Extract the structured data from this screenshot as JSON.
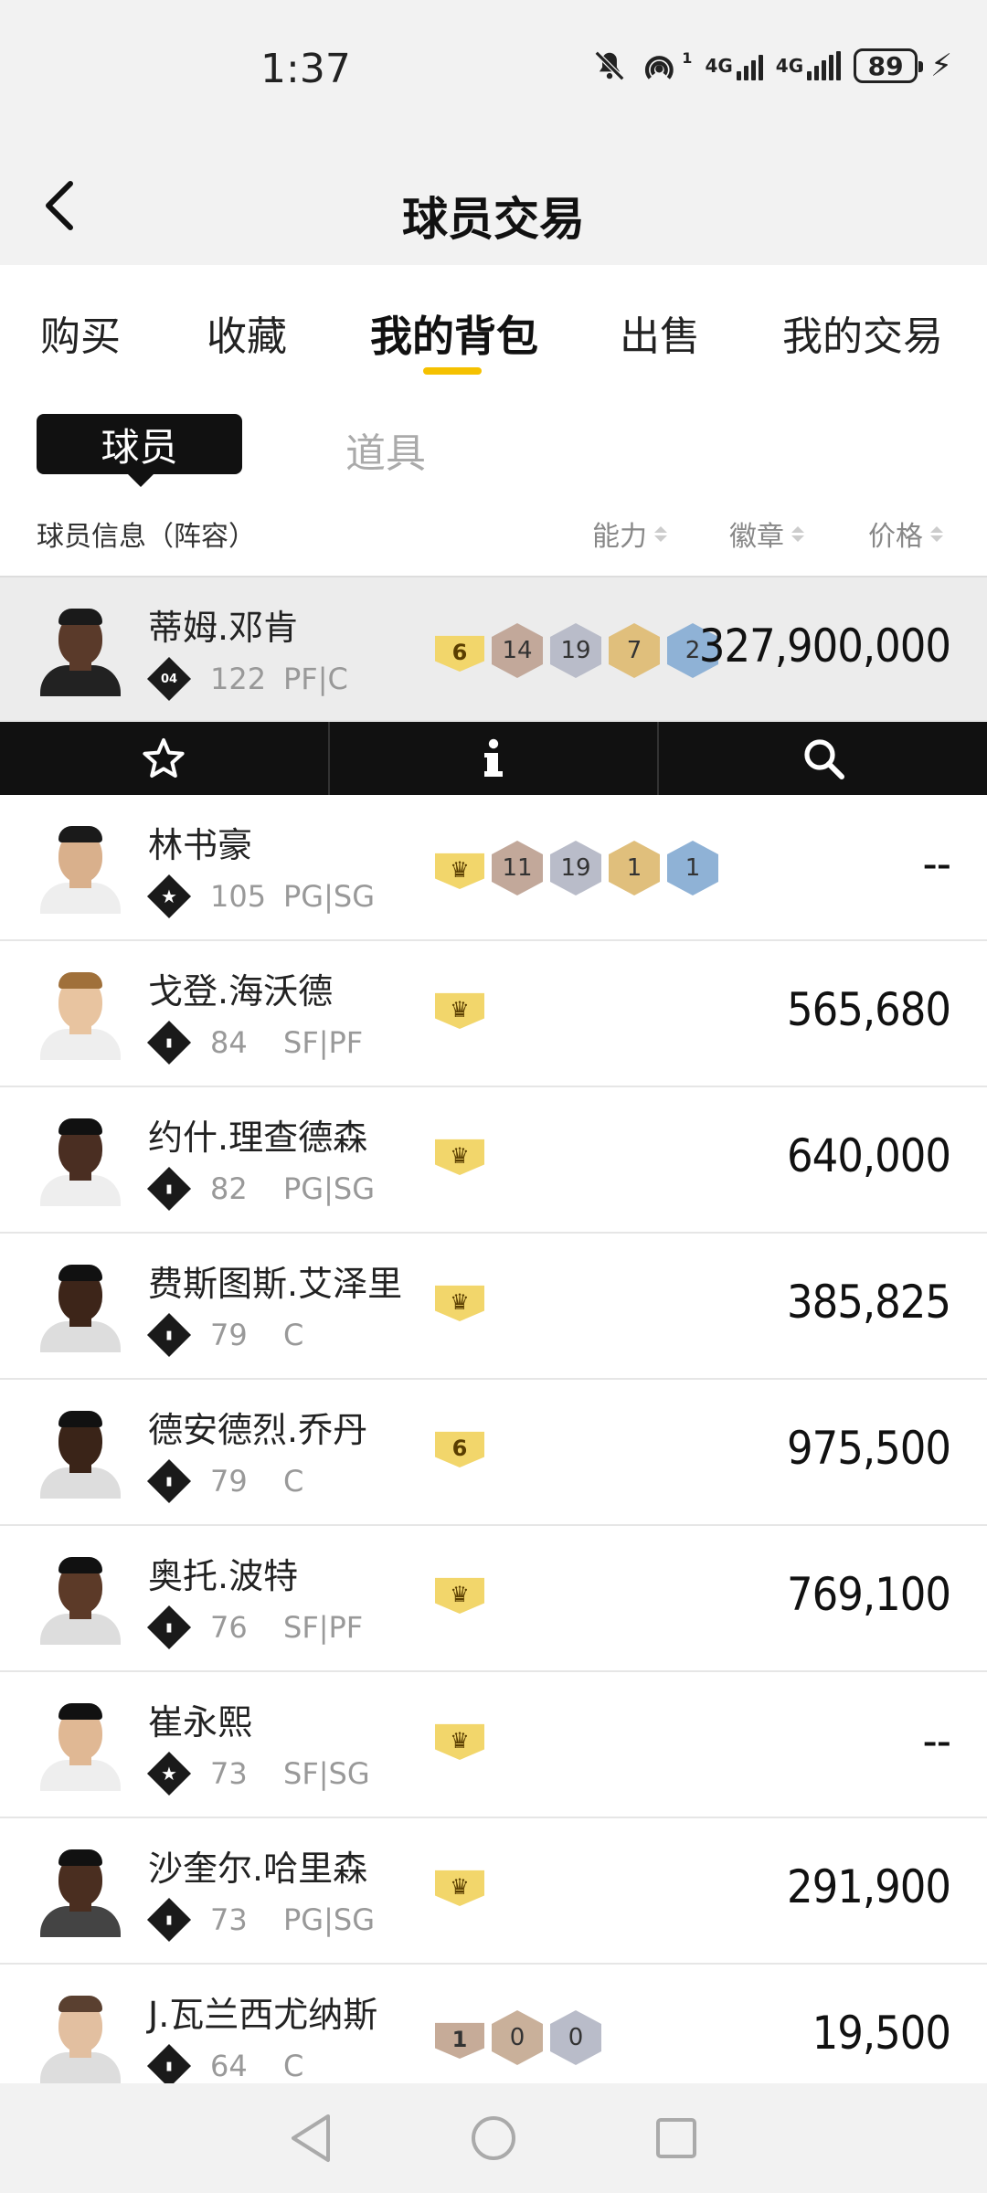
{
  "status_bar": {
    "time": "1:37",
    "battery": "89",
    "signal1_label": "4G",
    "signal2_label": "4G",
    "hotspot_sup": "1"
  },
  "header": {
    "title": "球员交易"
  },
  "tabs": [
    {
      "label": "购买"
    },
    {
      "label": "收藏"
    },
    {
      "label": "我的背包"
    },
    {
      "label": "出售"
    },
    {
      "label": "我的交易"
    }
  ],
  "subtabs": {
    "active": "球员",
    "other": "道具"
  },
  "columns": {
    "info": "球员信息（阵容）",
    "ability": "能力",
    "badge": "徽章",
    "price": "价格"
  },
  "players": [
    {
      "name": "蒂姆.邓肯",
      "rank": "04",
      "score": "122",
      "pos": "PF|C",
      "price": "327,900,000",
      "lead": "6",
      "hex": [
        "14",
        "19",
        "7",
        "2"
      ]
    },
    {
      "name": "林书豪",
      "rank": "★",
      "score": "105",
      "pos": "PG|SG",
      "price": "--",
      "lead": "♛",
      "hex": [
        "11",
        "19",
        "1",
        "1"
      ]
    },
    {
      "name": "戈登.海沃德",
      "rank": "▮",
      "score": "84",
      "pos": "SF|PF",
      "price": "565,680",
      "lead": "♛"
    },
    {
      "name": "约什.理查德森",
      "rank": "▮",
      "score": "82",
      "pos": "PG|SG",
      "price": "640,000",
      "lead": "♛"
    },
    {
      "name": "费斯图斯.艾泽里",
      "rank": "▮",
      "score": "79",
      "pos": "C",
      "price": "385,825",
      "lead": "♛"
    },
    {
      "name": "德安德烈.乔丹",
      "rank": "▮",
      "score": "79",
      "pos": "C",
      "price": "975,500",
      "lead": "6"
    },
    {
      "name": "奥托.波特",
      "rank": "▮",
      "score": "76",
      "pos": "SF|PF",
      "price": "769,100",
      "lead": "♛"
    },
    {
      "name": "崔永熙",
      "rank": "★",
      "score": "73",
      "pos": "SF|SG",
      "price": "--",
      "lead": "♛"
    },
    {
      "name": "沙奎尔.哈里森",
      "rank": "▮",
      "score": "73",
      "pos": "PG|SG",
      "price": "291,900",
      "lead": "♛"
    },
    {
      "name": "J.瓦兰西尤纳斯",
      "rank": "▮",
      "score": "64",
      "pos": "C",
      "price": "19,500",
      "lead": "1",
      "hex": [
        "0",
        "0"
      ]
    }
  ]
}
